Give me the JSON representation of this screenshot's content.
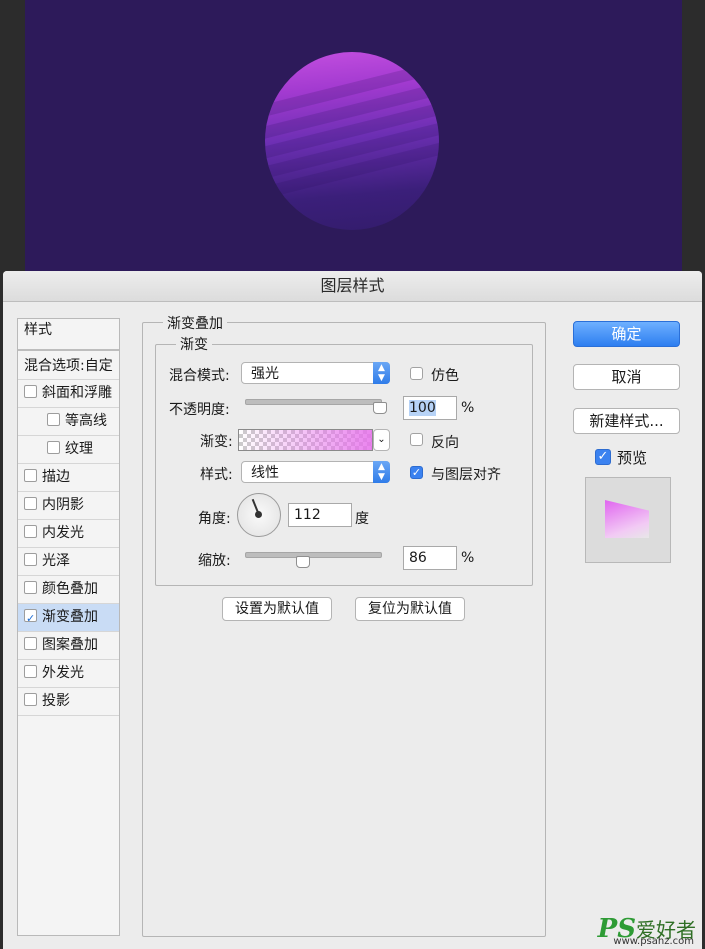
{
  "dialog": {
    "title": "图层样式"
  },
  "styles_panel": {
    "header": "样式",
    "blend_options": "混合选项:自定",
    "items": [
      {
        "label": "斜面和浮雕",
        "checked": false,
        "indent": false
      },
      {
        "label": "等高线",
        "checked": false,
        "indent": true
      },
      {
        "label": "纹理",
        "checked": false,
        "indent": true
      },
      {
        "label": "描边",
        "checked": false,
        "indent": false
      },
      {
        "label": "内阴影",
        "checked": false,
        "indent": false
      },
      {
        "label": "内发光",
        "checked": false,
        "indent": false
      },
      {
        "label": "光泽",
        "checked": false,
        "indent": false
      },
      {
        "label": "颜色叠加",
        "checked": false,
        "indent": false
      },
      {
        "label": "渐变叠加",
        "checked": true,
        "indent": false,
        "selected": true
      },
      {
        "label": "图案叠加",
        "checked": false,
        "indent": false
      },
      {
        "label": "外发光",
        "checked": false,
        "indent": false
      },
      {
        "label": "投影",
        "checked": false,
        "indent": false
      }
    ]
  },
  "gradient_overlay": {
    "section_title": "渐变叠加",
    "group_title": "渐变",
    "blend_mode_label": "混合模式:",
    "blend_mode_value": "强光",
    "dither_label": "仿色",
    "dither_checked": false,
    "opacity_label": "不透明度:",
    "opacity_value": "100",
    "opacity_fraction": 1.0,
    "percent": "%",
    "gradient_label": "渐变:",
    "reverse_label": "反向",
    "reverse_checked": false,
    "style_label": "样式:",
    "style_value": "线性",
    "align_label": "与图层对齐",
    "align_checked": true,
    "angle_label": "角度:",
    "angle_value": "112",
    "degree_unit": "度",
    "scale_label": "缩放:",
    "scale_value": "86",
    "scale_fraction": 0.43,
    "make_default": "设置为默认值",
    "reset_default": "复位为默认值"
  },
  "buttons": {
    "ok": "确定",
    "cancel": "取消",
    "new_style": "新建样式...",
    "preview_label": "预览",
    "preview_checked": true
  },
  "watermark": {
    "brand": "PS",
    "cn": "爱好者",
    "url": "www.psahz.com"
  }
}
